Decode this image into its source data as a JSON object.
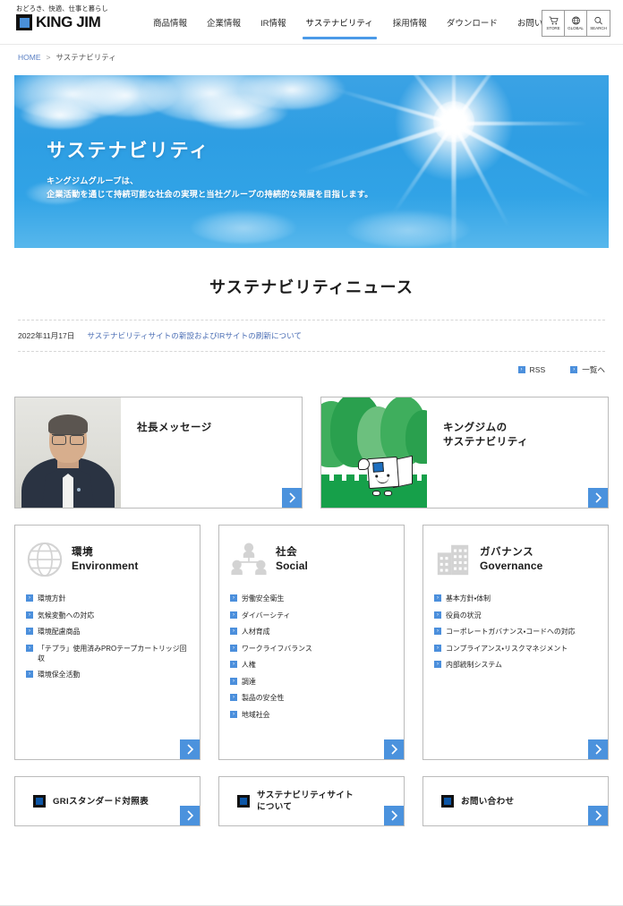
{
  "header": {
    "logo": {
      "tagline": "おどろき、快適、仕事と暮らし",
      "wordmark": "KING JIM",
      "mark_icon": "king-jim-square-logo"
    },
    "nav": [
      {
        "label": "商品情報",
        "active": false
      },
      {
        "label": "企業情報",
        "active": false
      },
      {
        "label": "IR情報",
        "active": false
      },
      {
        "label": "サステナビリティ",
        "active": true
      },
      {
        "label": "採用情報",
        "active": false
      },
      {
        "label": "ダウンロード",
        "active": false
      },
      {
        "label": "お問い合わせ",
        "active": false
      }
    ],
    "utilities": [
      {
        "label": "STORE",
        "icon": "shopping-cart-icon"
      },
      {
        "label": "GLOBAL",
        "icon": "globe-icon"
      },
      {
        "label": "SEARCH",
        "icon": "search-icon"
      }
    ]
  },
  "breadcrumb": {
    "home": "HOME",
    "separator": ">",
    "current": "サステナビリティ"
  },
  "hero": {
    "title": "サステナビリティ",
    "subtitle_line1": "キングジムグループは、",
    "subtitle_line2": "企業活動を通じて持続可能な社会の実現と当社グループの持続的な発展を目指します。",
    "background": "blue-sky-with-sun-and-clouds",
    "sky_color": "#2e9ee3"
  },
  "news": {
    "heading": "サステナビリティニュース",
    "items": [
      {
        "date": "2022年11月17日",
        "title": "サステナビリティサイトの新設およびIRサイトの刷新について"
      }
    ],
    "links": [
      {
        "label": "RSS",
        "icon": "blue-square-arrow-icon"
      },
      {
        "label": "一覧へ",
        "icon": "blue-square-arrow-icon"
      }
    ]
  },
  "features": [
    {
      "title": "社長メッセージ",
      "image": "president-portrait-photo",
      "arrow_icon": "chevron-right-icon"
    },
    {
      "title_line1": "キングジムの",
      "title_line2": "サステナビリティ",
      "image": "mascot-with-trees-illustration",
      "arrow_icon": "chevron-right-icon"
    }
  ],
  "esg": [
    {
      "ja": "環境",
      "en": "Environment",
      "icon": "globe-grid-icon",
      "items": [
        "環境方針",
        "気候変動への対応",
        "環境配慮商品",
        "「テプラ」使用済みPROテープカートリッジ回収",
        "環境保全活動"
      ],
      "arrow_icon": "chevron-right-icon"
    },
    {
      "ja": "社会",
      "en": "Social",
      "icon": "people-network-icon",
      "items": [
        "労働安全衛生",
        "ダイバーシティ",
        "人材育成",
        "ワークライフバランス",
        "人権",
        "調達",
        "製品の安全性",
        "地域社会"
      ],
      "arrow_icon": "chevron-right-icon"
    },
    {
      "ja": "ガバナンス",
      "en": "Governance",
      "icon": "office-building-icon",
      "items": [
        "基本方針・体制",
        "役員の状況",
        "コーポレートガバナンス・コードへの対応",
        "コンプライアンス・リスクマネジメント",
        "内部統制システム"
      ],
      "arrow_icon": "chevron-right-icon"
    }
  ],
  "bottom_cards": [
    {
      "label": "GRIスタンダード対照表",
      "icon": "king-jim-square-logo",
      "arrow_icon": "chevron-right-icon"
    },
    {
      "label_line1": "サステナビリティサイト",
      "label_line2": "について",
      "icon": "king-jim-square-logo",
      "arrow_icon": "chevron-right-icon"
    },
    {
      "label": "お問い合わせ",
      "icon": "king-jim-square-logo",
      "arrow_icon": "chevron-right-icon"
    }
  ],
  "colors": {
    "accent_blue": "#4b92dd",
    "nav_active": "#4b9ae8",
    "link_blue": "#4c6fb5",
    "logo_blue": "#4a90d9"
  }
}
